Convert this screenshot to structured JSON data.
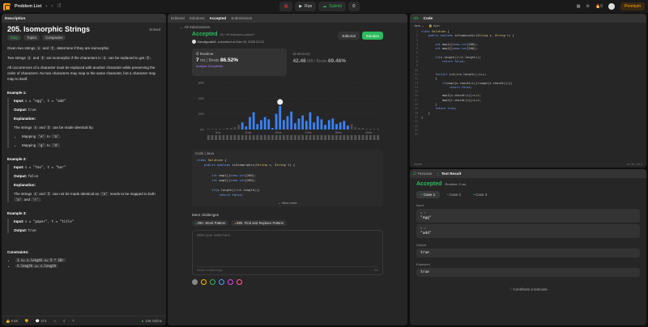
{
  "topbar": {
    "title": "Problem List",
    "run": "Run",
    "submit": "Submit",
    "count": "0",
    "premium": "Premium"
  },
  "desc": {
    "tab": "Description",
    "title": "205. Isomorphic Strings",
    "solved": "Solved",
    "tags": [
      "Easy",
      "Topics",
      "Companies"
    ],
    "p1a": "Given two strings",
    "s": "s",
    "and": "and",
    "t": "t",
    "p1b": ", determine if they are isomorphic.",
    "p2a": "Two strings",
    "p2b": "are isomorphic if the characters in",
    "p2c": "can be replaced to get",
    "p3": "All occurrences of a character must be replaced with another character while preserving the order of characters. No two characters may map to the same character, but a character may map to itself.",
    "ex1": "Example 1:",
    "ex1_in": "s = \"egg\", t = \"add\"",
    "ex1_out": "true",
    "explanation": "Explanation:",
    "ex1_exp": "The strings",
    "ex1_exp2": "can be made identical by:",
    "ex1_b1": "Mapping",
    "ex1_b1a": "'e'",
    "to": "to",
    "ex1_b1b": "'a'",
    "ex1_b2a": "'g'",
    "ex1_b2b": "'d'",
    "ex2": "Example 2:",
    "ex2_in": "s = \"foo\", t = \"bar\"",
    "ex2_out": "false",
    "ex2_exp": "The strings",
    "ex2_exp2": "can not be made identical as",
    "ex2_exp3": "needs to be mapped to both",
    "ex2_o": "'o'",
    "ex2_a": "'a'",
    "ex2_r": "'r'",
    "and2": "and",
    "ex3": "Example 3:",
    "ex3_in": "s = \"paper\", t = \"title\"",
    "ex3_out": "true",
    "input_lbl": "Input:",
    "output_lbl": "Output:",
    "constraints": "Constraints:",
    "c1": "1 <= s.length <= 5 * 10⁴",
    "c2": "t.length == s.length",
    "likes": "9.5K",
    "comments": "374",
    "online": "148 Online"
  },
  "sub": {
    "tabs": [
      "Editorial",
      "Solutions",
      "Accepted",
      "Submissions"
    ],
    "back": "All Submissions",
    "status": "Accepted",
    "passed": "45 / 45 testcases passed",
    "user": "DevAyushG",
    "submitted": "submitted at Mar 03, 2025 22:12",
    "editorial": "Editorial",
    "solution": "Solution",
    "runtime": "Runtime",
    "rt_val": "7",
    "rt_unit": "ms",
    "beats": "Beats",
    "rt_pct": "86.52%",
    "analyze": "Analyze Complexity",
    "memory": "Memory",
    "mem_val": "42.46",
    "mem_unit": "MB",
    "mem_pct": "69.46%",
    "code_h": "Code | Java",
    "more": "More challenges",
    "ch1": "290. Word Pattern",
    "ch2": "890. Find and Replace Pattern",
    "notes_ph": "Write your notes here",
    "tags_ph": "Select related tags",
    "notes_count": "0/5",
    "view_more": "View more"
  },
  "chart_data": {
    "type": "bar",
    "title": "",
    "xlabel": "",
    "ylabel": "",
    "ylim": [
      0,
      60
    ],
    "yticks": [
      "60%",
      "40%",
      "20%",
      "0%"
    ],
    "x": [
      1,
      2,
      3,
      4,
      5,
      6,
      7,
      8,
      9,
      10,
      11,
      12,
      13,
      14,
      15,
      16,
      17,
      18,
      19,
      20,
      21,
      22,
      23,
      24,
      25,
      26,
      27,
      28,
      29,
      30,
      31,
      32,
      33,
      34,
      35,
      36,
      37,
      38,
      39,
      40,
      41,
      42,
      43,
      44,
      45,
      46
    ],
    "values": [
      1,
      1,
      1,
      1,
      1,
      2,
      2,
      3,
      6,
      9,
      4,
      16,
      22,
      7,
      12,
      16,
      13,
      2,
      20,
      30,
      12,
      17,
      23,
      8,
      14,
      18,
      11,
      22,
      9,
      17,
      13,
      6,
      12,
      14,
      7,
      9,
      11,
      5,
      7,
      3,
      2,
      2,
      1,
      1,
      1,
      1
    ],
    "xtick_labels": [
      "3ms",
      "11ms",
      "19ms",
      "27ms",
      "35ms",
      "43ms"
    ],
    "highlight": 19
  },
  "code": {
    "lang": "Java",
    "auto": "Auto",
    "foot_l": "Saved",
    "foot_r": "Ln 15, Col 2"
  },
  "test": {
    "tab1": "Testcase",
    "tab2": "Test Result",
    "status": "Accepted",
    "runtime": "Runtime: 0 ms",
    "cases": [
      "Case 1",
      "Case 2",
      "Case 3"
    ],
    "input": "Input",
    "s_lbl": "s =",
    "s_val": "\"egg\"",
    "t_lbl": "t =",
    "t_val": "\"add\"",
    "output": "Output",
    "out_val": "true",
    "expected": "Expected",
    "exp_val": "true",
    "contrib": "Contribute a testcase"
  }
}
